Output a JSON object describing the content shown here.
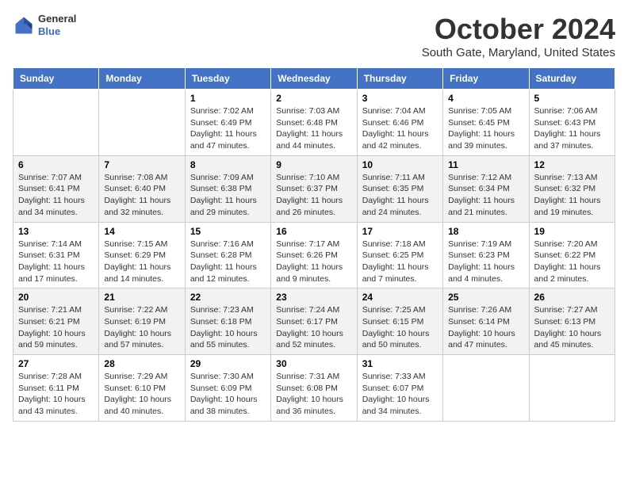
{
  "header": {
    "logo": {
      "line1": "General",
      "line2": "Blue"
    },
    "title": "October 2024",
    "location": "South Gate, Maryland, United States"
  },
  "days_of_week": [
    "Sunday",
    "Monday",
    "Tuesday",
    "Wednesday",
    "Thursday",
    "Friday",
    "Saturday"
  ],
  "weeks": [
    [
      {
        "day": "",
        "sunrise": "",
        "sunset": "",
        "daylight": ""
      },
      {
        "day": "",
        "sunrise": "",
        "sunset": "",
        "daylight": ""
      },
      {
        "day": "1",
        "sunrise": "Sunrise: 7:02 AM",
        "sunset": "Sunset: 6:49 PM",
        "daylight": "Daylight: 11 hours and 47 minutes."
      },
      {
        "day": "2",
        "sunrise": "Sunrise: 7:03 AM",
        "sunset": "Sunset: 6:48 PM",
        "daylight": "Daylight: 11 hours and 44 minutes."
      },
      {
        "day": "3",
        "sunrise": "Sunrise: 7:04 AM",
        "sunset": "Sunset: 6:46 PM",
        "daylight": "Daylight: 11 hours and 42 minutes."
      },
      {
        "day": "4",
        "sunrise": "Sunrise: 7:05 AM",
        "sunset": "Sunset: 6:45 PM",
        "daylight": "Daylight: 11 hours and 39 minutes."
      },
      {
        "day": "5",
        "sunrise": "Sunrise: 7:06 AM",
        "sunset": "Sunset: 6:43 PM",
        "daylight": "Daylight: 11 hours and 37 minutes."
      }
    ],
    [
      {
        "day": "6",
        "sunrise": "Sunrise: 7:07 AM",
        "sunset": "Sunset: 6:41 PM",
        "daylight": "Daylight: 11 hours and 34 minutes."
      },
      {
        "day": "7",
        "sunrise": "Sunrise: 7:08 AM",
        "sunset": "Sunset: 6:40 PM",
        "daylight": "Daylight: 11 hours and 32 minutes."
      },
      {
        "day": "8",
        "sunrise": "Sunrise: 7:09 AM",
        "sunset": "Sunset: 6:38 PM",
        "daylight": "Daylight: 11 hours and 29 minutes."
      },
      {
        "day": "9",
        "sunrise": "Sunrise: 7:10 AM",
        "sunset": "Sunset: 6:37 PM",
        "daylight": "Daylight: 11 hours and 26 minutes."
      },
      {
        "day": "10",
        "sunrise": "Sunrise: 7:11 AM",
        "sunset": "Sunset: 6:35 PM",
        "daylight": "Daylight: 11 hours and 24 minutes."
      },
      {
        "day": "11",
        "sunrise": "Sunrise: 7:12 AM",
        "sunset": "Sunset: 6:34 PM",
        "daylight": "Daylight: 11 hours and 21 minutes."
      },
      {
        "day": "12",
        "sunrise": "Sunrise: 7:13 AM",
        "sunset": "Sunset: 6:32 PM",
        "daylight": "Daylight: 11 hours and 19 minutes."
      }
    ],
    [
      {
        "day": "13",
        "sunrise": "Sunrise: 7:14 AM",
        "sunset": "Sunset: 6:31 PM",
        "daylight": "Daylight: 11 hours and 17 minutes."
      },
      {
        "day": "14",
        "sunrise": "Sunrise: 7:15 AM",
        "sunset": "Sunset: 6:29 PM",
        "daylight": "Daylight: 11 hours and 14 minutes."
      },
      {
        "day": "15",
        "sunrise": "Sunrise: 7:16 AM",
        "sunset": "Sunset: 6:28 PM",
        "daylight": "Daylight: 11 hours and 12 minutes."
      },
      {
        "day": "16",
        "sunrise": "Sunrise: 7:17 AM",
        "sunset": "Sunset: 6:26 PM",
        "daylight": "Daylight: 11 hours and 9 minutes."
      },
      {
        "day": "17",
        "sunrise": "Sunrise: 7:18 AM",
        "sunset": "Sunset: 6:25 PM",
        "daylight": "Daylight: 11 hours and 7 minutes."
      },
      {
        "day": "18",
        "sunrise": "Sunrise: 7:19 AM",
        "sunset": "Sunset: 6:23 PM",
        "daylight": "Daylight: 11 hours and 4 minutes."
      },
      {
        "day": "19",
        "sunrise": "Sunrise: 7:20 AM",
        "sunset": "Sunset: 6:22 PM",
        "daylight": "Daylight: 11 hours and 2 minutes."
      }
    ],
    [
      {
        "day": "20",
        "sunrise": "Sunrise: 7:21 AM",
        "sunset": "Sunset: 6:21 PM",
        "daylight": "Daylight: 10 hours and 59 minutes."
      },
      {
        "day": "21",
        "sunrise": "Sunrise: 7:22 AM",
        "sunset": "Sunset: 6:19 PM",
        "daylight": "Daylight: 10 hours and 57 minutes."
      },
      {
        "day": "22",
        "sunrise": "Sunrise: 7:23 AM",
        "sunset": "Sunset: 6:18 PM",
        "daylight": "Daylight: 10 hours and 55 minutes."
      },
      {
        "day": "23",
        "sunrise": "Sunrise: 7:24 AM",
        "sunset": "Sunset: 6:17 PM",
        "daylight": "Daylight: 10 hours and 52 minutes."
      },
      {
        "day": "24",
        "sunrise": "Sunrise: 7:25 AM",
        "sunset": "Sunset: 6:15 PM",
        "daylight": "Daylight: 10 hours and 50 minutes."
      },
      {
        "day": "25",
        "sunrise": "Sunrise: 7:26 AM",
        "sunset": "Sunset: 6:14 PM",
        "daylight": "Daylight: 10 hours and 47 minutes."
      },
      {
        "day": "26",
        "sunrise": "Sunrise: 7:27 AM",
        "sunset": "Sunset: 6:13 PM",
        "daylight": "Daylight: 10 hours and 45 minutes."
      }
    ],
    [
      {
        "day": "27",
        "sunrise": "Sunrise: 7:28 AM",
        "sunset": "Sunset: 6:11 PM",
        "daylight": "Daylight: 10 hours and 43 minutes."
      },
      {
        "day": "28",
        "sunrise": "Sunrise: 7:29 AM",
        "sunset": "Sunset: 6:10 PM",
        "daylight": "Daylight: 10 hours and 40 minutes."
      },
      {
        "day": "29",
        "sunrise": "Sunrise: 7:30 AM",
        "sunset": "Sunset: 6:09 PM",
        "daylight": "Daylight: 10 hours and 38 minutes."
      },
      {
        "day": "30",
        "sunrise": "Sunrise: 7:31 AM",
        "sunset": "Sunset: 6:08 PM",
        "daylight": "Daylight: 10 hours and 36 minutes."
      },
      {
        "day": "31",
        "sunrise": "Sunrise: 7:33 AM",
        "sunset": "Sunset: 6:07 PM",
        "daylight": "Daylight: 10 hours and 34 minutes."
      },
      {
        "day": "",
        "sunrise": "",
        "sunset": "",
        "daylight": ""
      },
      {
        "day": "",
        "sunrise": "",
        "sunset": "",
        "daylight": ""
      }
    ]
  ]
}
